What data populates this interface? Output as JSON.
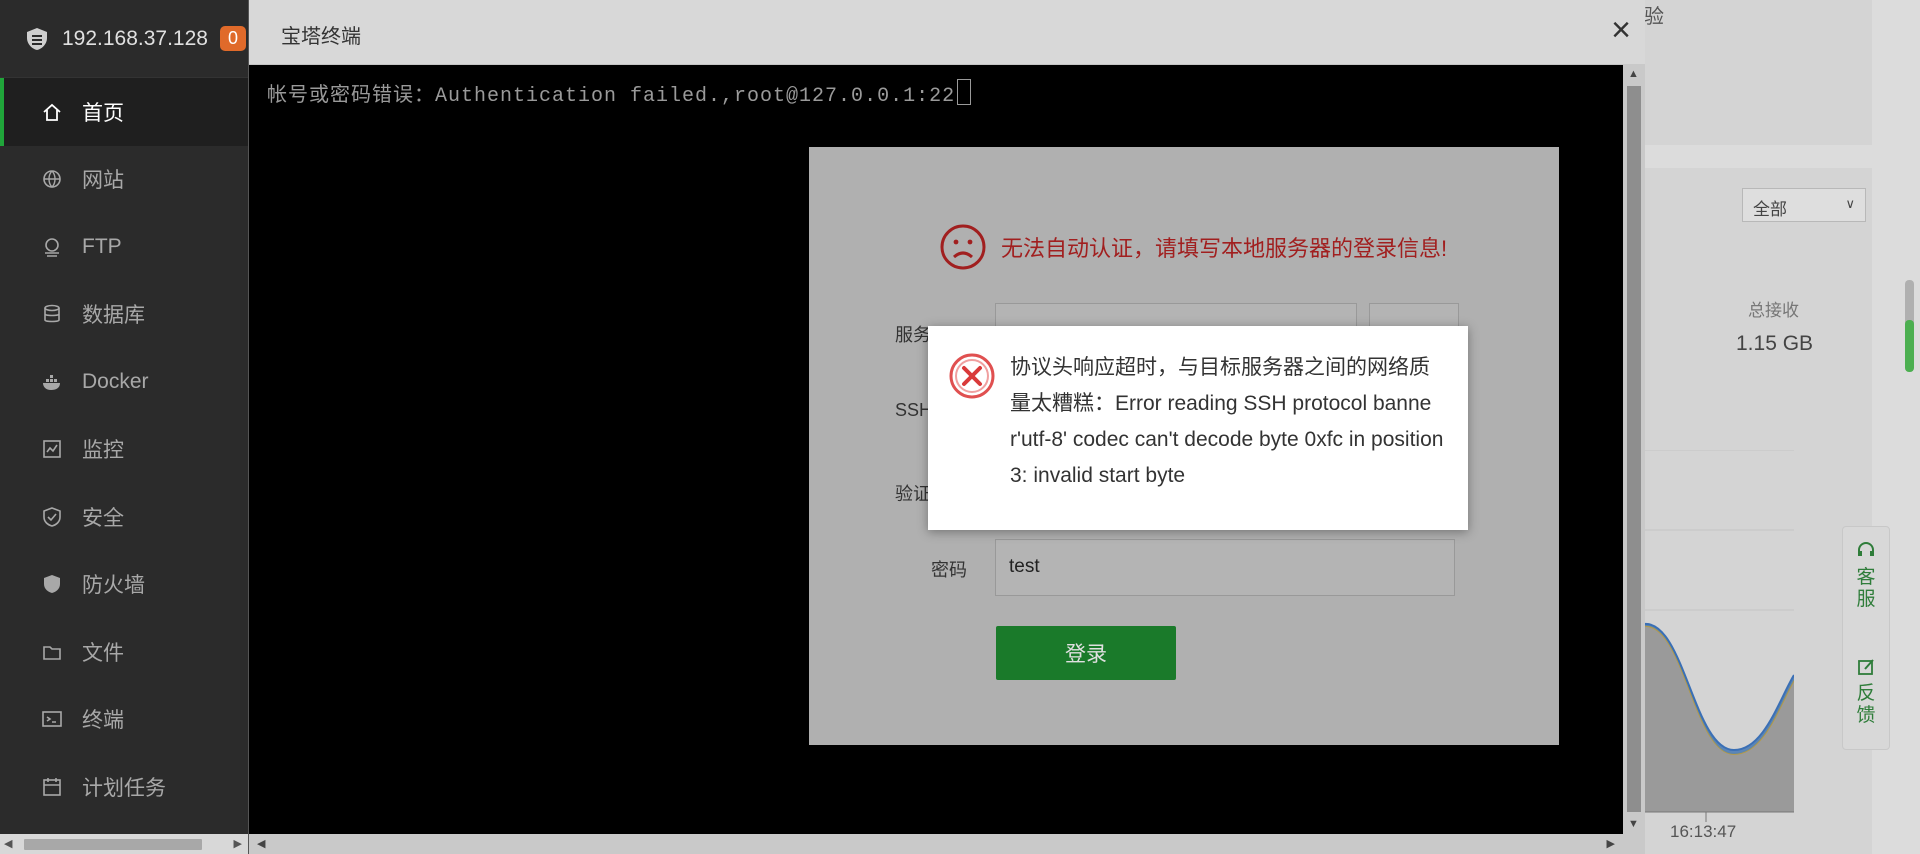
{
  "sidebar": {
    "ip": "192.168.37.128",
    "badge": "0",
    "items": [
      {
        "label": "首页",
        "icon": "home-icon",
        "active": true
      },
      {
        "label": "网站",
        "icon": "globe-icon"
      },
      {
        "label": "FTP",
        "icon": "ftp-icon"
      },
      {
        "label": "数据库",
        "icon": "database-icon"
      },
      {
        "label": "Docker",
        "icon": "docker-icon"
      },
      {
        "label": "监控",
        "icon": "monitor-icon"
      },
      {
        "label": "安全",
        "icon": "shield-icon"
      },
      {
        "label": "防火墙",
        "icon": "firewall-icon"
      },
      {
        "label": "文件",
        "icon": "folder-icon"
      },
      {
        "label": "终端",
        "icon": "terminal-icon"
      },
      {
        "label": "计划任务",
        "icon": "calendar-icon"
      }
    ]
  },
  "terminal": {
    "title": "宝塔终端",
    "close": "×",
    "output": "帐号或密码错误：Authentication failed.,root@127.0.0.1:22"
  },
  "login_dialog": {
    "heading": "无法自动认证，请填写本地服务器的登录信息!",
    "server_label": "服务",
    "ssh_label": "SSH",
    "verify_label": "验证",
    "password_label": "密码",
    "password_value": "test",
    "login_button": "登录"
  },
  "error_toast": {
    "message": "协议头响应超时，与目标服务器之间的网络质量太糟糕：Error reading SSH protocol banner'utf-8' codec can't decode byte 0xfc in position 3: invalid start byte"
  },
  "dashboard": {
    "card_title_fragment": "验",
    "filter_select": "全部",
    "total_receive_label": "总接收",
    "total_receive_value": "1.15 GB",
    "chart_time_label": "16:13:47"
  },
  "float_panel": {
    "service": "客服",
    "feedback": "反馈"
  },
  "colors": {
    "accent_green": "#20a53a",
    "error_red": "#a11f1f",
    "login_button": "#1a7a2a"
  }
}
